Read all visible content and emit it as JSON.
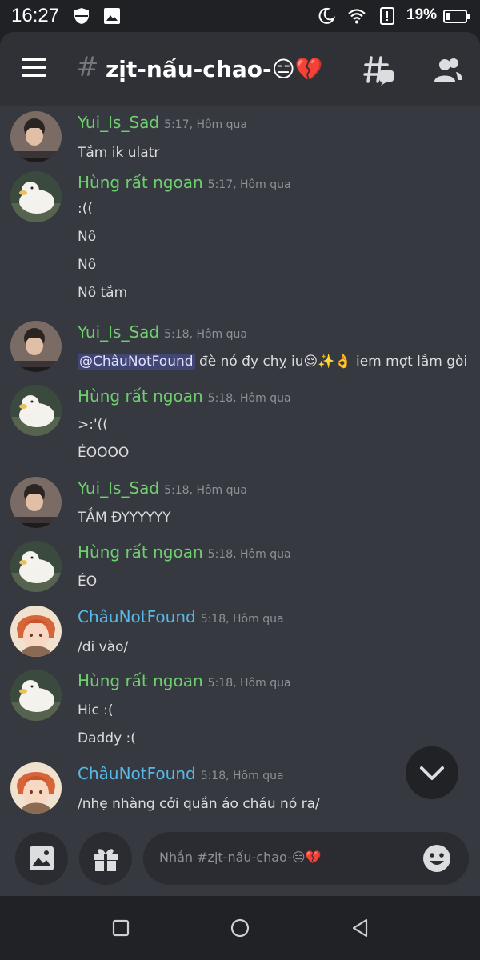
{
  "status_bar": {
    "time": "16:27",
    "battery": "19%"
  },
  "channel": {
    "hash": "#",
    "name": "zịt-nấu-chao-😑💔"
  },
  "messages": [
    {
      "user": "Yui_Is_Sad",
      "color": "#6fcf6f",
      "time": "5:17, Hôm qua",
      "lines": [
        "Tắm ik ulatr"
      ],
      "avatar": "person"
    },
    {
      "user": "Hùng rất ngoan",
      "color": "#6fcf6f",
      "time": "5:17, Hôm qua",
      "lines": [
        ":((",
        "Nô",
        "Nô",
        "Nô tắm"
      ],
      "avatar": "duck"
    },
    {
      "user": "Yui_Is_Sad",
      "color": "#6fcf6f",
      "time": "5:18, Hôm qua",
      "mention": "@ChâuNotFound",
      "lines": [
        " đè nó đy chỵ iu😌✨👌 iem mợt lắm gòi"
      ],
      "avatar": "person"
    },
    {
      "user": "Hùng rất ngoan",
      "color": "#6fcf6f",
      "time": "5:18, Hôm qua",
      "lines": [
        ">:'((",
        "ÉOOOO"
      ],
      "avatar": "duck"
    },
    {
      "user": "Yui_Is_Sad",
      "color": "#6fcf6f",
      "time": "5:18, Hôm qua",
      "lines": [
        "TẮM ĐYYYYYY"
      ],
      "avatar": "person"
    },
    {
      "user": "Hùng rất ngoan",
      "color": "#6fcf6f",
      "time": "5:18, Hôm qua",
      "lines": [
        "ÉO"
      ],
      "avatar": "duck"
    },
    {
      "user": "ChâuNotFound",
      "color": "#58b8e8",
      "time": "5:18, Hôm qua",
      "lines": [
        "/đi vào/"
      ],
      "avatar": "anime"
    },
    {
      "user": "Hùng rất ngoan",
      "color": "#6fcf6f",
      "time": "5:18, Hôm qua",
      "lines": [
        "Hic :(",
        "Daddy :("
      ],
      "avatar": "duck"
    },
    {
      "user": "ChâuNotFound",
      "color": "#58b8e8",
      "time": "5:18, Hôm qua",
      "lines": [
        "/nhẹ nhàng cởi quần áo cháu nó ra/"
      ],
      "avatar": "anime"
    }
  ],
  "input": {
    "placeholder": "Nhắn #zịt-nấu-chao-😑💔"
  },
  "icons": [
    "menu-icon",
    "threads-icon",
    "members-icon",
    "image-icon",
    "gift-icon",
    "emoji-icon",
    "chevron-down-icon",
    "wifi-icon",
    "moon-icon",
    "battery-icon"
  ]
}
